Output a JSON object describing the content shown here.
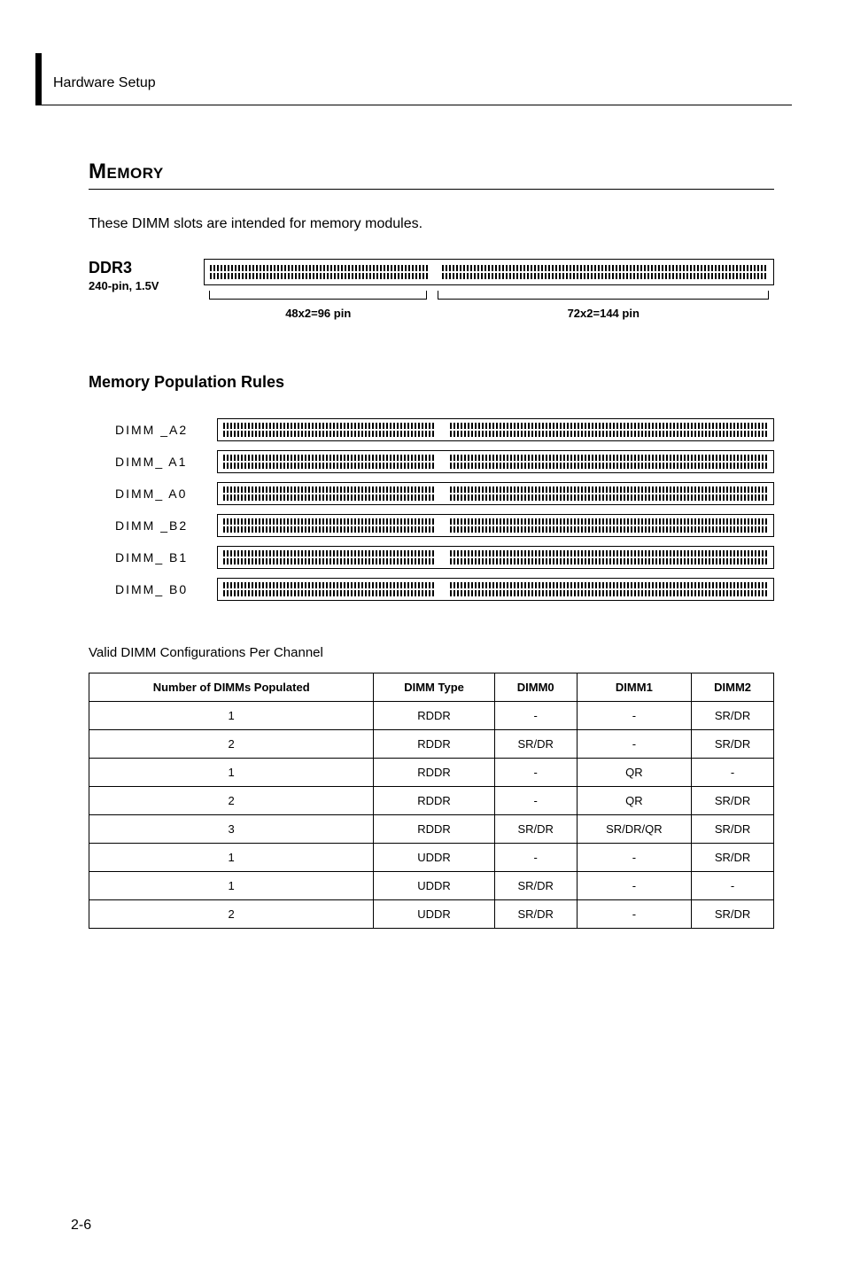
{
  "header": {
    "section": "Hardware Setup"
  },
  "memory": {
    "title": "Memory",
    "intro": "These DIMM slots are intended for memory modules.",
    "ddr3": {
      "title": "DDR3",
      "subtitle": "240-pin, 1.5V",
      "left_pin_label": "48x2=96 pin",
      "right_pin_label": "72x2=144  pin"
    },
    "rules_title": "Memory Population Rules",
    "slots": [
      {
        "label": "DIMM _A2"
      },
      {
        "label": "DIMM_ A1"
      },
      {
        "label": "DIMM_ A0"
      },
      {
        "label": "DIMM _B2"
      },
      {
        "label": "DIMM_ B1"
      },
      {
        "label": "DIMM_ B0"
      }
    ],
    "table": {
      "caption": "Valid DIMM Configurations Per Channel",
      "headers": {
        "col0": "Number of DIMMs Populated",
        "col1": "DIMM Type",
        "col2": "DIMM0",
        "col3": "DIMM1",
        "col4": "DIMM2"
      },
      "rows": [
        {
          "c0": "1",
          "c1": "RDDR",
          "c2": "-",
          "c3": "-",
          "c4": "SR/DR"
        },
        {
          "c0": "2",
          "c1": "RDDR",
          "c2": "SR/DR",
          "c3": "-",
          "c4": "SR/DR"
        },
        {
          "c0": "1",
          "c1": "RDDR",
          "c2": "-",
          "c3": "QR",
          "c4": "-"
        },
        {
          "c0": "2",
          "c1": "RDDR",
          "c2": "-",
          "c3": "QR",
          "c4": "SR/DR"
        },
        {
          "c0": "3",
          "c1": "RDDR",
          "c2": "SR/DR",
          "c3": "SR/DR/QR",
          "c4": "SR/DR"
        },
        {
          "c0": "1",
          "c1": "UDDR",
          "c2": "-",
          "c3": "-",
          "c4": "SR/DR"
        },
        {
          "c0": "1",
          "c1": "UDDR",
          "c2": "SR/DR",
          "c3": "-",
          "c4": "-"
        },
        {
          "c0": "2",
          "c1": "UDDR",
          "c2": "SR/DR",
          "c3": "-",
          "c4": "SR/DR"
        }
      ]
    }
  },
  "page_number": "2-6"
}
